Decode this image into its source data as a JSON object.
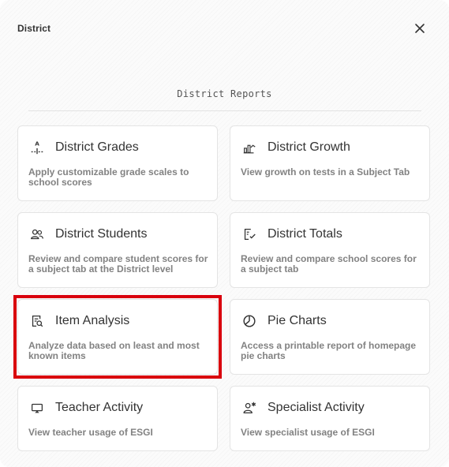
{
  "header": {
    "title": "District"
  },
  "section": {
    "title": "District Reports"
  },
  "reports": [
    {
      "title": "District Grades",
      "description": "Apply customizable grade scales to school scores",
      "icon": "grade-scale-icon"
    },
    {
      "title": "District Growth",
      "description": "View growth on tests in a Subject Tab",
      "icon": "growth-chart-icon"
    },
    {
      "title": "District Students",
      "description": "Review and compare student scores for a subject tab at the District level",
      "icon": "students-icon"
    },
    {
      "title": "District Totals",
      "description": "Review and compare school scores for a subject tab",
      "icon": "totals-checklist-icon"
    },
    {
      "title": "Item Analysis",
      "description": "Analyze data based on least and most known items",
      "icon": "item-analysis-icon"
    },
    {
      "title": "Pie Charts",
      "description": "Access a printable report of homepage pie charts",
      "icon": "pie-chart-icon"
    },
    {
      "title": "Teacher Activity",
      "description": "View teacher usage of ESGI",
      "icon": "teacher-activity-icon"
    },
    {
      "title": "Specialist Activity",
      "description": "View specialist usage of ESGI",
      "icon": "specialist-activity-icon"
    }
  ],
  "highlight_color": "#d9000d"
}
